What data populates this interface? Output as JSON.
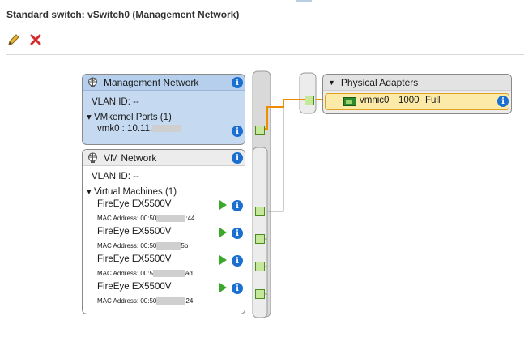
{
  "title": "Standard switch: vSwitch0 (Management Network)",
  "toolbar": {
    "edit_icon": "pencil-icon",
    "remove_icon": "red-x-icon"
  },
  "mgmt": {
    "name": "Management Network",
    "vlan": "VLAN ID: --",
    "ports_label": "VMkernel Ports (1)",
    "vmk_prefix": "vmk0 : 10.11."
  },
  "vmnet": {
    "name": "VM Network",
    "vlan": "VLAN ID: --",
    "vms_label": "Virtual Machines (1)",
    "vms": [
      {
        "name": "FireEye EX5500V",
        "mac_prefix": "MAC Address: 00:50",
        "mac_suffix": ":44"
      },
      {
        "name": "FireEye EX5500V",
        "mac_prefix": "MAC Address: 00:50",
        "mac_suffix": "5b"
      },
      {
        "name": "FireEye EX5500V",
        "mac_prefix": "MAC Address: 00:5",
        "mac_suffix": "ad"
      },
      {
        "name": "FireEye EX5500V",
        "mac_prefix": "MAC Address: 00:50",
        "mac_suffix": "24"
      }
    ]
  },
  "physical": {
    "title": "Physical Adapters",
    "adapter": {
      "name": "vmnic0",
      "speed": "1000",
      "duplex": "Full"
    }
  },
  "colors": {
    "mgmt_fill": "#c5d9f1",
    "selected_line": "#f08c00",
    "info": "#1a6fd1"
  }
}
